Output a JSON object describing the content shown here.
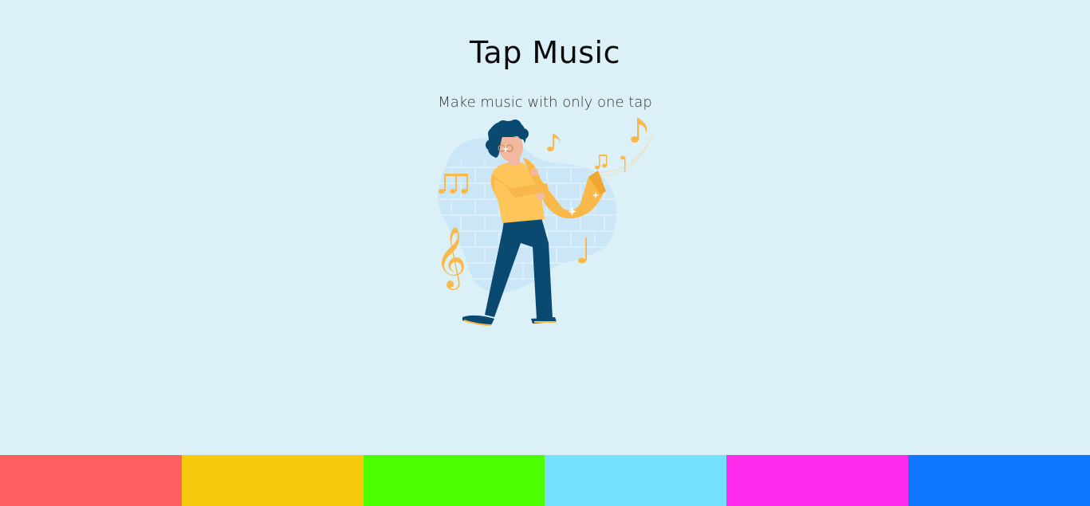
{
  "header": {
    "title": "Tap Music",
    "subtitle": "Make music with only one tap"
  },
  "illustration": {
    "name": "saxophone-player",
    "colors": {
      "hair": "#0b4a70",
      "skin": "#f2b9a0",
      "shirt": "#fec65a",
      "pants": "#0b4a70",
      "saxophone": "#f8b94a",
      "notes": "#f8b94a",
      "wall": "#c9e6f6"
    }
  },
  "pads": [
    {
      "id": "pad-1",
      "color": "#ff5f5f"
    },
    {
      "id": "pad-2",
      "color": "#f7cb0c"
    },
    {
      "id": "pad-3",
      "color": "#4dff00"
    },
    {
      "id": "pad-4",
      "color": "#73e1fc"
    },
    {
      "id": "pad-5",
      "color": "#ff2ced"
    },
    {
      "id": "pad-6",
      "color": "#0f78ff"
    }
  ]
}
